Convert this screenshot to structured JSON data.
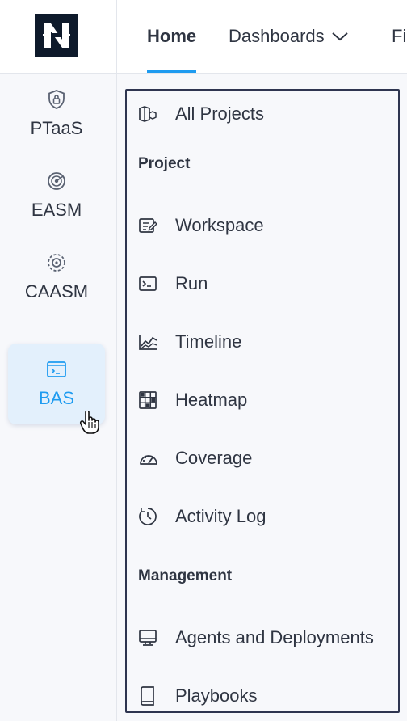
{
  "header": {
    "logo_alt": "N",
    "tabs": [
      {
        "label": "Home"
      },
      {
        "label": "Dashboards"
      },
      {
        "label": "Fi"
      }
    ]
  },
  "rail": {
    "items": [
      {
        "label": "PTaaS",
        "icon": "shield-lock-icon"
      },
      {
        "label": "EASM",
        "icon": "radar-icon"
      },
      {
        "label": "CAASM",
        "icon": "asset-target-icon"
      },
      {
        "label": "BAS",
        "icon": "terminal-window-icon",
        "active": true
      }
    ]
  },
  "menu": {
    "all_projects": "All Projects",
    "sections": [
      {
        "title": "Project",
        "items": [
          "Workspace",
          "Run",
          "Timeline",
          "Heatmap",
          "Coverage",
          "Activity Log"
        ]
      },
      {
        "title": "Management",
        "items": [
          "Agents and Deployments",
          "Playbooks"
        ]
      }
    ]
  },
  "colors": {
    "accent": "#1e9bf0",
    "active_bg": "#e3f0fc",
    "logo_bg": "#0e1a2b",
    "menu_border": "#2e3550"
  }
}
